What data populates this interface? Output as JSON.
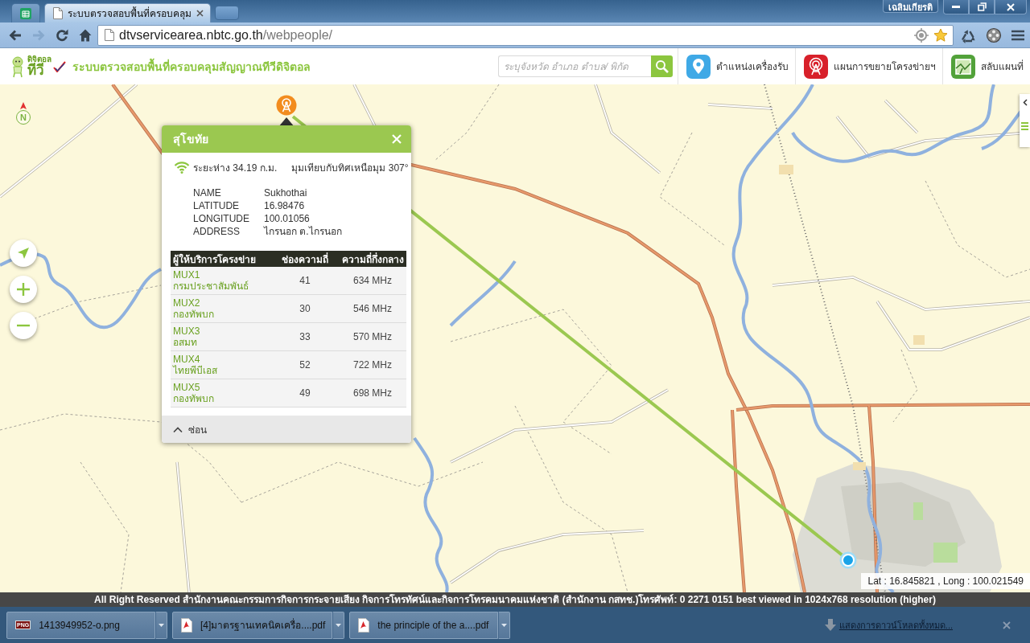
{
  "browser": {
    "tabs": [
      {
        "kind": "pinned",
        "selected": false
      },
      {
        "kind": "page",
        "title": "ระบบตรวจสอบพื้นที่ครอบคลุม",
        "selected": true
      }
    ],
    "profile": "เฉลิมเกียรติ",
    "nav": [
      {
        "kind": "back",
        "disabled": false
      },
      {
        "kind": "forward",
        "disabled": true
      },
      {
        "kind": "reload",
        "disabled": false
      },
      {
        "kind": "home",
        "disabled": false
      }
    ],
    "address": {
      "host": "dtvservicearea.nbtc.go.th",
      "path": "/webpeople/"
    },
    "starred": true
  },
  "header": {
    "logo": {
      "top": "ดิจิตอล",
      "bottom": "ทีวี"
    },
    "title": "ระบบตรวจสอบพื้นที่ครอบคลุมสัญญาณทีวีดิจิตอล",
    "search": {
      "placeholder": "ระบุจังหวัด อำเภอ ตำบล/ พิกัด"
    },
    "menu": [
      {
        "kind": "receiver",
        "label": "ตำแหน่งเครื่องรับ"
      },
      {
        "kind": "network",
        "label": "แผนการขยายโครงข่ายฯ"
      },
      {
        "kind": "basemap",
        "label": "สลับแผนที่"
      }
    ]
  },
  "map": {
    "compass": "N",
    "controls": [
      {
        "kind": "locate"
      },
      {
        "kind": "zoom_in"
      },
      {
        "kind": "zoom_out"
      }
    ],
    "coordinates": "Lat : 16.845821 , Long : 100.021549",
    "popup": {
      "title": "สุโขทัย",
      "distance": "ระยะห่าง 34.19 ก.ม.",
      "bearing": "มุมเทียบกับทิศเหนือมุม 307°",
      "info": [
        {
          "label": "NAME",
          "value": "Sukhothai"
        },
        {
          "label": "LATITUDE",
          "value": "16.98476"
        },
        {
          "label": "LONGITUDE",
          "value": "100.01056"
        },
        {
          "label": "ADDRESS",
          "value": "ไกรนอก ต.ไกรนอก"
        }
      ],
      "table": {
        "columns": [
          "ผู้ให้บริการโครงข่าย",
          "ช่องความถี่",
          "ความถี่กึ่งกลาง"
        ],
        "rows": [
          {
            "mux": "MUX1",
            "operator": "กรมประชาสัมพันธ์",
            "channel": "41",
            "frequency": "634 MHz"
          },
          {
            "mux": "MUX2",
            "operator": "กองทัพบก",
            "channel": "30",
            "frequency": "546 MHz"
          },
          {
            "mux": "MUX3",
            "operator": "อสมท",
            "channel": "33",
            "frequency": "570 MHz"
          },
          {
            "mux": "MUX4",
            "operator": "ไทยพีบีเอส",
            "channel": "52",
            "frequency": "722 MHz"
          },
          {
            "mux": "MUX5",
            "operator": "กองทัพบก",
            "channel": "49",
            "frequency": "698 MHz"
          }
        ]
      },
      "hide": "ซ่อน"
    }
  },
  "footer": "All Right Reserved สำนักงานคณะกรรมการกิจการกระจายเสียง กิจการโทรทัศน์และกิจการโทรคมนาคมแห่งชาติ (สำนักงาน กสทช.)โทรศัพท์: 0 2271 0151 best viewed in 1024x768 resolution (higher)",
  "downloads": {
    "items": [
      {
        "kind": "png",
        "badge": "PNG",
        "name": "1413949952-o.png"
      },
      {
        "kind": "pdf",
        "name": "[4]มาตรฐานเทคนิคเครื่อ....pdf"
      },
      {
        "kind": "pdf",
        "name": "the principle of the a....pdf"
      }
    ],
    "show_all": "แสดงการดาวน์โหลดทั้งหมด..."
  }
}
